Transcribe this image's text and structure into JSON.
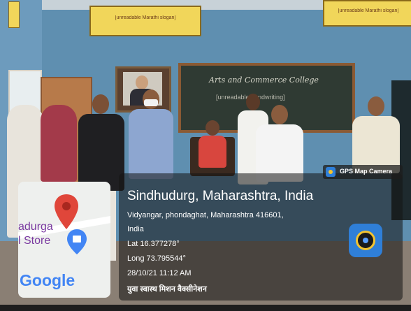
{
  "wall_banner_left": "[unreadable Marathi slogan]",
  "wall_banner_right": "[unreadable Marathi slogan]",
  "blackboard": {
    "line1": "Arts and Commerce College",
    "line2": "[unreadable handwriting]"
  },
  "overlay": {
    "app_badge": "GPS Map Camera",
    "location_title": "Sindhudurg, Maharashtra, India",
    "address_line1": "Vidyangar, phondaghat, Maharashtra 416601,",
    "address_line2": "India",
    "lat": "Lat 16.377278°",
    "long": "Long 73.795544°",
    "datetime": "28/10/21 11:12 AM",
    "caption": "युवा स्वास्थ मिशन वैक्सीनेशन"
  },
  "map": {
    "place_fragment_1": "adurga",
    "place_fragment_2": "l Store",
    "logo": "Google",
    "pin_icon": "map-pin-icon",
    "shop_icon": "shopping-bag-icon"
  },
  "colors": {
    "wall": "#5f8fb0",
    "banner": "#f1d65a",
    "blackboard": "#2f3a33",
    "overlay_bg": "rgba(20,20,20,0.55)",
    "pin_red": "#e0463a",
    "google_blue": "#4285f4"
  }
}
